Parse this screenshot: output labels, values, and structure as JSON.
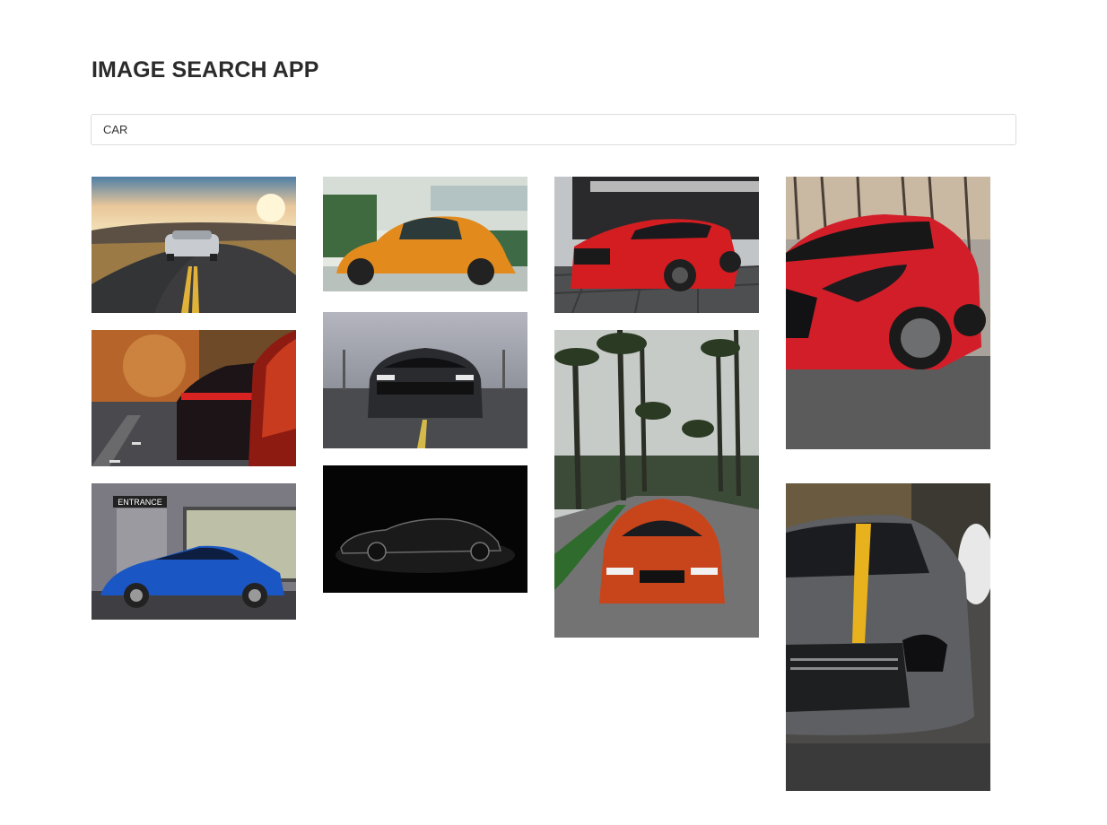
{
  "app": {
    "title": "IMAGE SEARCH APP"
  },
  "search": {
    "value": "CAR"
  },
  "results": [
    {
      "subject": "silver sports car on a curving road at sunset"
    },
    {
      "subject": "orange vintage beetle in front of a building"
    },
    {
      "subject": "red mustang parked on cobblestones"
    },
    {
      "subject": "red hatchback front close-up"
    },
    {
      "subject": "dark car taillights on a city street"
    },
    {
      "subject": "black muscle car on a road"
    },
    {
      "subject": "orange BMW on a palm tree lined street"
    },
    {
      "subject": "blue coupe in front of an entrance"
    },
    {
      "subject": "black sedan silhouette on a dark background"
    },
    {
      "subject": "grey Mercedes with yellow stripe"
    }
  ],
  "overlay_text": {
    "entrance_sign": "ENTRANCE"
  },
  "colors": {
    "title": "#2b2b2b",
    "input_border": "#dcdcdc"
  }
}
